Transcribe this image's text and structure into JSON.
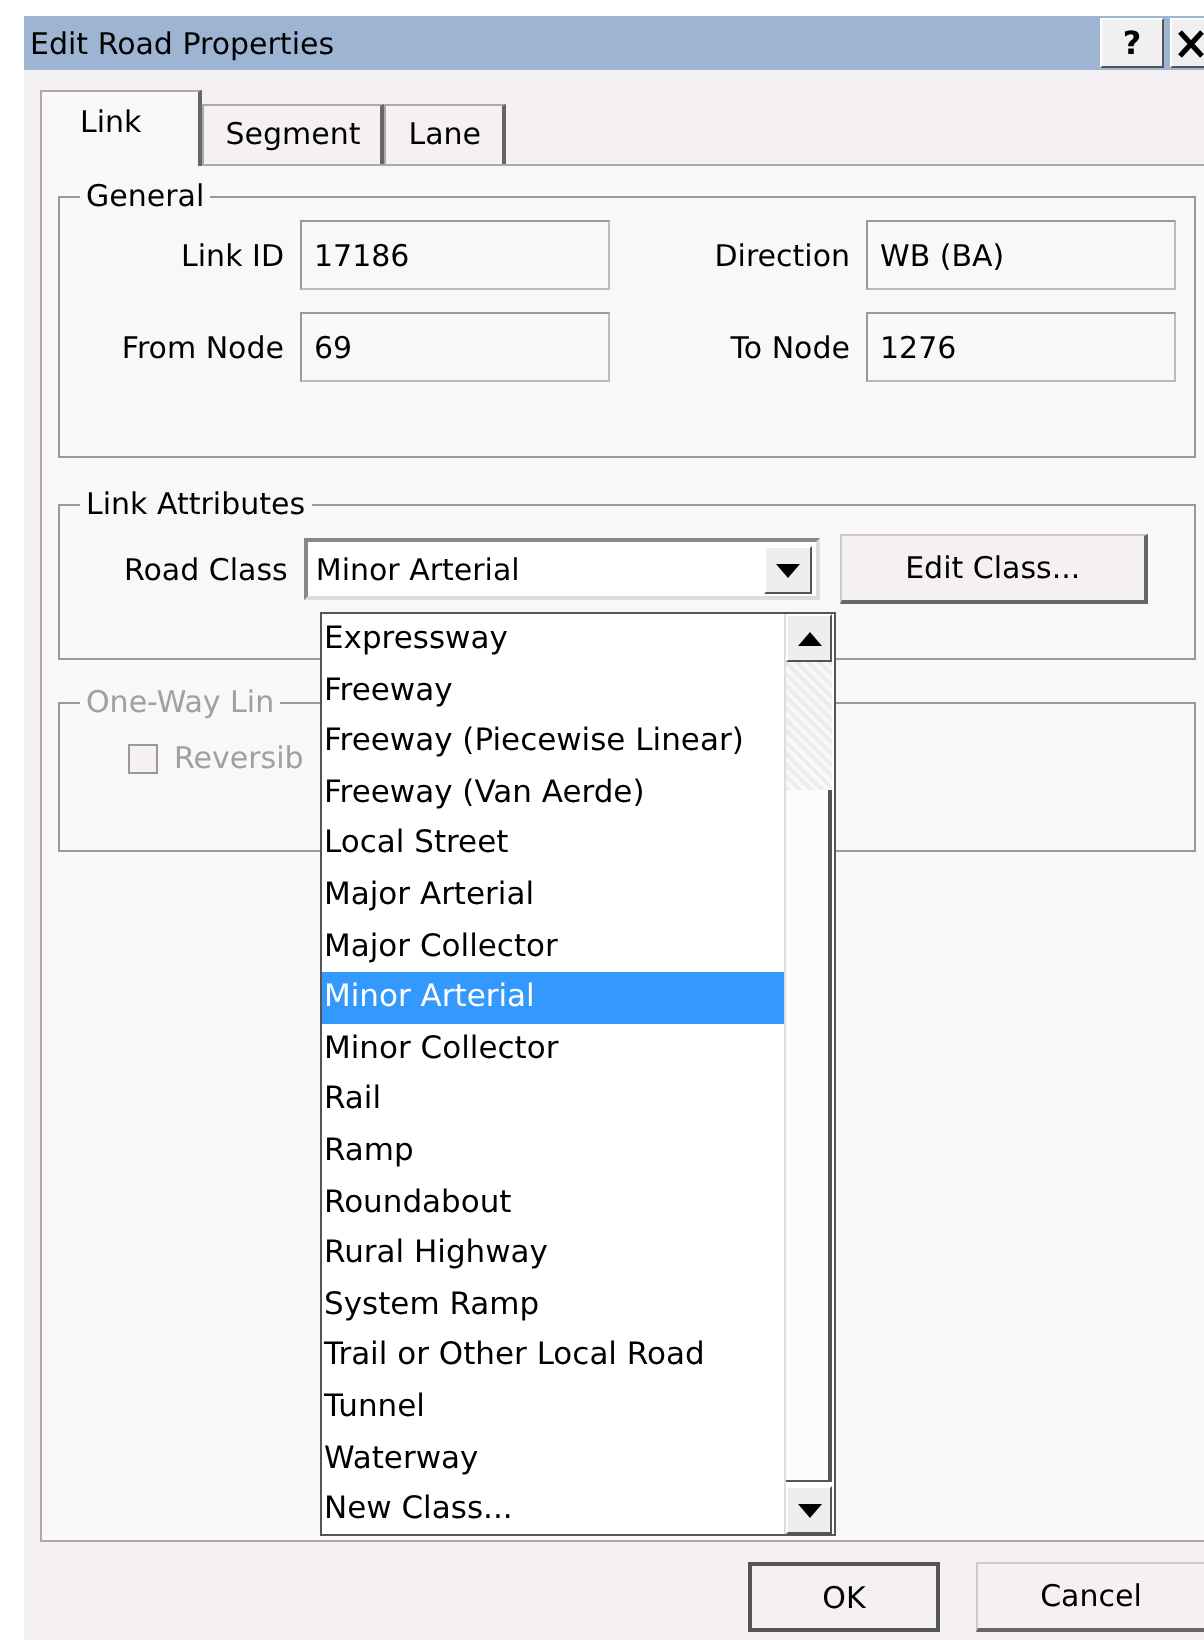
{
  "window": {
    "title": "Edit Road Properties",
    "help_button": "?"
  },
  "tabs": [
    {
      "label": "Link",
      "selected": true
    },
    {
      "label": "Segment",
      "selected": false
    },
    {
      "label": "Lane",
      "selected": false
    }
  ],
  "general": {
    "title": "General",
    "fields": [
      {
        "label": "Link ID",
        "value": "17186"
      },
      {
        "label": "Direction",
        "value": "WB (BA)"
      },
      {
        "label": "From Node",
        "value": "69"
      },
      {
        "label": "To Node",
        "value": "1276"
      }
    ]
  },
  "link_attributes": {
    "title": "Link Attributes",
    "road_class": {
      "label": "Road Class",
      "value": "Minor Arterial"
    },
    "edit_button": "Edit Class..."
  },
  "one_way": {
    "title": "One-Way Lin",
    "disabled": true,
    "checkbox": {
      "label": "Reversib",
      "checked": false
    }
  },
  "dropdown": {
    "items": [
      {
        "label": "Expressway",
        "selected": false
      },
      {
        "label": "Freeway",
        "selected": false
      },
      {
        "label": "Freeway (Piecewise Linear)",
        "selected": false
      },
      {
        "label": "Freeway (Van Aerde)",
        "selected": false
      },
      {
        "label": "Local Street",
        "selected": false
      },
      {
        "label": "Major Arterial",
        "selected": false
      },
      {
        "label": "Major Collector",
        "selected": false
      },
      {
        "label": "Minor Arterial",
        "selected": true
      },
      {
        "label": "Minor Collector",
        "selected": false
      },
      {
        "label": "Rail",
        "selected": false
      },
      {
        "label": "Ramp",
        "selected": false
      },
      {
        "label": "Roundabout",
        "selected": false
      },
      {
        "label": "Rural Highway",
        "selected": false
      },
      {
        "label": "System Ramp",
        "selected": false
      },
      {
        "label": "Trail or Other Local Road",
        "selected": false
      },
      {
        "label": "Tunnel",
        "selected": false
      },
      {
        "label": "Waterway",
        "selected": false
      },
      {
        "label": "New Class...",
        "selected": false
      }
    ]
  },
  "buttons": [
    "OK",
    "Cancel"
  ]
}
